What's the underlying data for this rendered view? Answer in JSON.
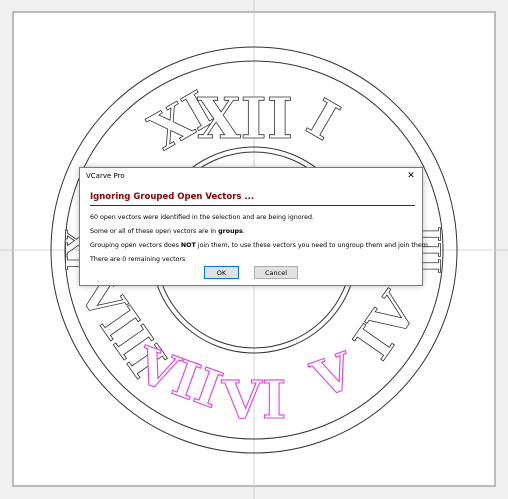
{
  "dialog": {
    "title": "VCarve Pro",
    "close_glyph": "✕",
    "heading": "Ignoring Grouped Open Vectors ...",
    "line1": "60 open vectors were identified in the selection and are being ignored.",
    "line2_pre": "Some or all of these open vectors are in ",
    "line2_bold": "groups",
    "line2_post": ".",
    "line3_pre": "Grouping open vectors does ",
    "line3_bold": "NOT",
    "line3_post": " join them, to use these vectors you need to ungroup them and join them.",
    "line4": "There are 0 remaining vectors",
    "ok_label": "OK",
    "cancel_label": "Cancel"
  },
  "numerals": {
    "top": [
      "XI",
      "XII",
      "I"
    ],
    "left": "IX",
    "right": "III",
    "lower_left": "VIII",
    "lower_right": "IV",
    "bottom": [
      "VII",
      "VI",
      "V"
    ]
  },
  "colors": {
    "outline": "#333333",
    "selected": "#e040e0",
    "heading": "#8b0000",
    "accent": "#0078d7"
  }
}
